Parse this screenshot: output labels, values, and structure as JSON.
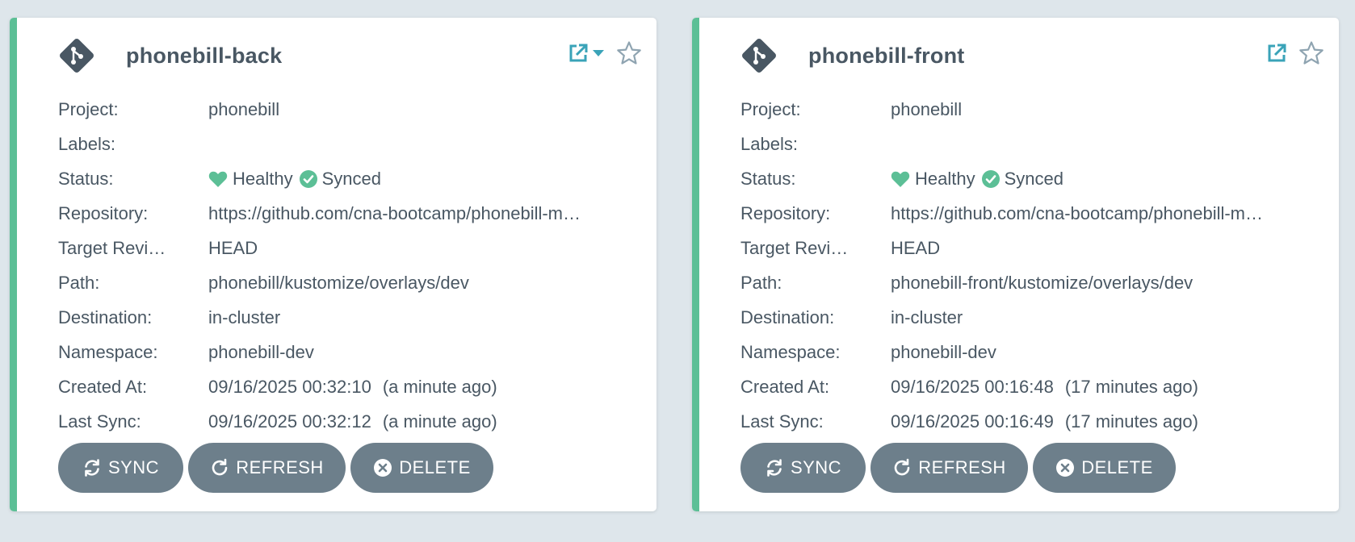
{
  "colors": {
    "background": "#dee6eb",
    "accent_synced": "#5cbf96",
    "text": "#495763",
    "button_bg": "#6d7f8b",
    "link_icon": "#3aa3b8",
    "star": "#8fa4b1"
  },
  "labels": {
    "project": "Project:",
    "labels": "Labels:",
    "status": "Status:",
    "repository": "Repository:",
    "target_revision": "Target Revi…",
    "path": "Path:",
    "destination": "Destination:",
    "namespace": "Namespace:",
    "created_at": "Created At:",
    "last_sync": "Last Sync:"
  },
  "buttons": {
    "sync": "SYNC",
    "refresh": "REFRESH",
    "delete": "DELETE"
  },
  "apps": [
    {
      "name": "phonebill-back",
      "project": "phonebill",
      "labels": "",
      "health": "Healthy",
      "sync_status": "Synced",
      "repository": "https://github.com/cna-bootcamp/phonebill-m…",
      "target_revision": "HEAD",
      "path": "phonebill/kustomize/overlays/dev",
      "destination": "in-cluster",
      "namespace": "phonebill-dev",
      "created_at": "09/16/2025 00:32:10",
      "created_ago": "(a minute ago)",
      "last_sync": "09/16/2025 00:32:12",
      "last_sync_ago": "(a minute ago)",
      "has_link_dropdown": true,
      "header_icons": [
        "external-link-icon",
        "caret-down-icon",
        "star-icon"
      ]
    },
    {
      "name": "phonebill-front",
      "project": "phonebill",
      "labels": "",
      "health": "Healthy",
      "sync_status": "Synced",
      "repository": "https://github.com/cna-bootcamp/phonebill-m…",
      "target_revision": "HEAD",
      "path": "phonebill-front/kustomize/overlays/dev",
      "destination": "in-cluster",
      "namespace": "phonebill-dev",
      "created_at": "09/16/2025 00:16:48",
      "created_ago": "(17 minutes ago)",
      "last_sync": "09/16/2025 00:16:49",
      "last_sync_ago": "(17 minutes ago)",
      "has_link_dropdown": false,
      "header_icons": [
        "external-link-icon",
        "star-icon"
      ]
    }
  ]
}
